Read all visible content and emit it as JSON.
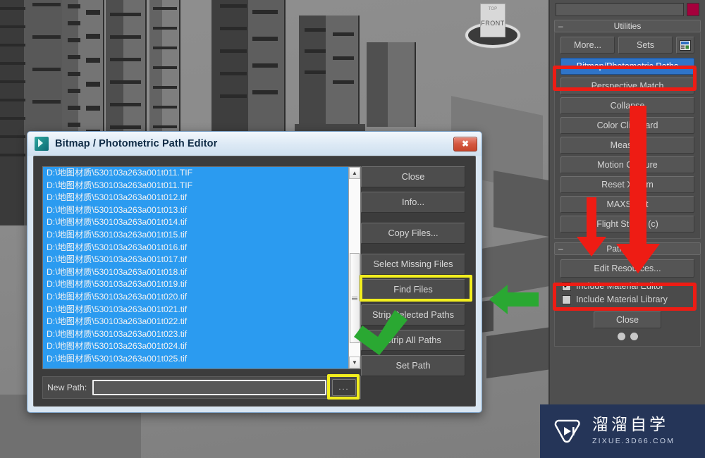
{
  "viewport": {
    "viewcube": {
      "top_label": "TOP",
      "front_label": "FRONT"
    }
  },
  "command_panel": {
    "utilities": {
      "title": "Utilities",
      "more_label": "More...",
      "sets_label": "Sets",
      "config_icon": "configure-button-sets-icon",
      "buttons": [
        {
          "label": "Bitmap/Photometric Paths",
          "active": true
        },
        {
          "label": "Perspective Match",
          "active": false
        },
        {
          "label": "Collapse",
          "active": false
        },
        {
          "label": "Color Clipboard",
          "active": false
        },
        {
          "label": "Measure",
          "active": false
        },
        {
          "label": "Motion Capture",
          "active": false
        },
        {
          "label": "Reset XForm",
          "active": false
        },
        {
          "label": "MAXScript",
          "active": false
        },
        {
          "label": "Flight Studio (c)",
          "active": false
        }
      ]
    },
    "path_editor": {
      "title": "Path Editor",
      "edit_resources_label": "Edit Resources...",
      "checkboxes": [
        {
          "label": "Include Material Editor",
          "checked": true,
          "mark": "✔"
        },
        {
          "label": "Include Material Library",
          "checked": false,
          "mark": ""
        }
      ],
      "close_label": "Close"
    }
  },
  "dialog": {
    "title": "Bitmap / Photometric Path Editor",
    "close_glyph": "✖",
    "app_icon": "max-app-icon",
    "files": [
      "D:\\地图材质\\530103a263a001t011.TIF",
      "D:\\地图材质\\530103a263a001t011.TIF",
      "D:\\地图材质\\530103a263a001t012.tif",
      "D:\\地图材质\\530103a263a001t013.tif",
      "D:\\地图材质\\530103a263a001t014.tif",
      "D:\\地图材质\\530103a263a001t015.tif",
      "D:\\地图材质\\530103a263a001t016.tif",
      "D:\\地图材质\\530103a263a001t017.tif",
      "D:\\地图材质\\530103a263a001t018.tif",
      "D:\\地图材质\\530103a263a001t019.tif",
      "D:\\地图材质\\530103a263a001t020.tif",
      "D:\\地图材质\\530103a263a001t021.tif",
      "D:\\地图材质\\530103a263a001t022.tif",
      "D:\\地图材质\\530103a263a001t023.tif",
      "D:\\地图材质\\530103a263a001t024.tif",
      "D:\\地图材质\\530103a263a001t025.tif"
    ],
    "buttons": {
      "close": "Close",
      "info": "Info...",
      "copy_files": "Copy Files...",
      "select_missing_files": "Select Missing Files",
      "find_files": "Find Files",
      "strip_selected_paths": "Strip Selected Paths",
      "strip_all_paths": "Strip All Paths",
      "set_path": "Set Path"
    },
    "new_path": {
      "label": "New Path:",
      "value": "",
      "browse_label": "..."
    },
    "scrollbar": {
      "up_glyph": "▲",
      "down_glyph": "▼"
    }
  },
  "annotations": {
    "highlight_yellow_color": "#f2ee1e",
    "highlight_red_color": "#ee1c14",
    "arrow_green_color": "#2aa832",
    "arrow_red_color": "#ee1c14"
  },
  "watermark": {
    "brand_cn": "溜溜自学",
    "brand_en": "ZIXUE.3D66.COM",
    "logo_icon": "play-button-logo-icon",
    "bg_color": "#253558"
  }
}
